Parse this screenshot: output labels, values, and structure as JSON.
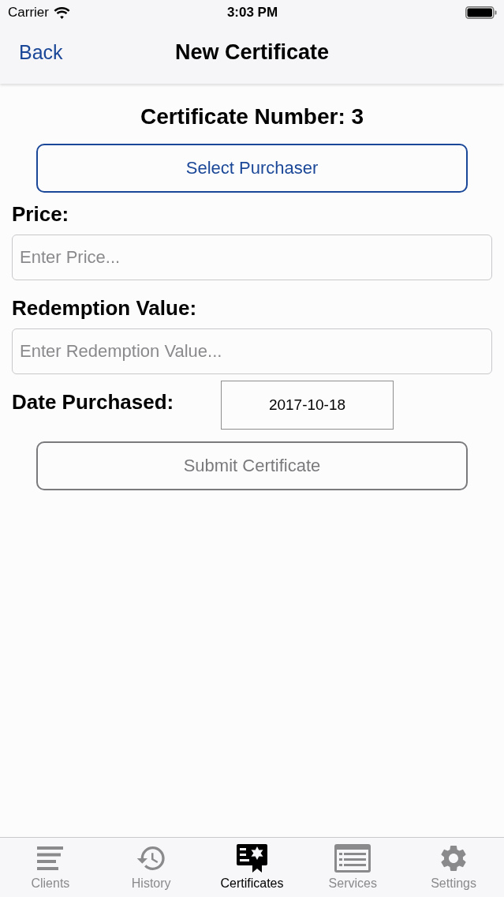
{
  "status_bar": {
    "carrier": "Carrier",
    "time": "3:03 PM"
  },
  "nav_bar": {
    "back": "Back",
    "title": "New Certificate"
  },
  "heading": "Certificate Number: 3",
  "select_button": {
    "label": "Select Purchaser"
  },
  "fields": [
    {
      "label": "Price:",
      "placeholder": "Enter Price..."
    },
    {
      "label": "Redemption Value:",
      "placeholder": "Enter Redemption Value..."
    }
  ],
  "date": {
    "label": "Date Purchased:",
    "value": "2017-10-18"
  },
  "submit_button": {
    "label": "Submit Certificate",
    "disabled": true
  },
  "tab_bar": [
    {
      "label": "Clients",
      "selected": false
    },
    {
      "label": "History",
      "selected": false
    },
    {
      "label": "Certificates",
      "selected": true
    },
    {
      "label": "Services",
      "selected": false
    },
    {
      "label": "Settings",
      "selected": false
    }
  ]
}
